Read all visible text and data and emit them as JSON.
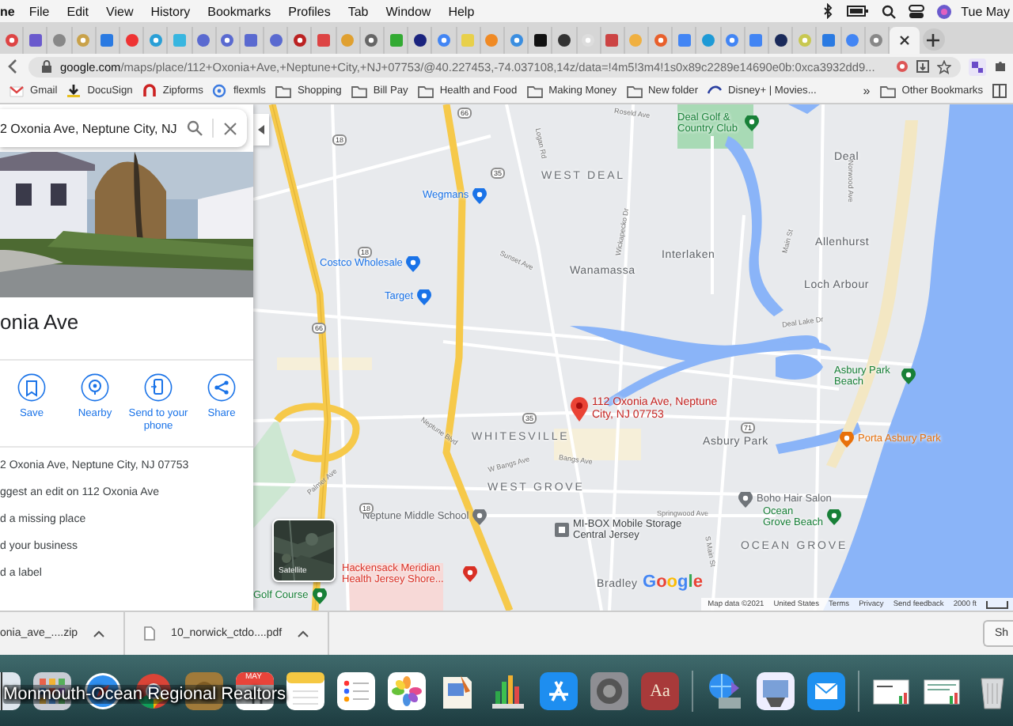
{
  "menu_bar": {
    "app": "ne",
    "menus": [
      "File",
      "Edit",
      "View",
      "History",
      "Bookmarks",
      "Profiles",
      "Tab",
      "Window",
      "Help"
    ],
    "clock": "Tue May"
  },
  "tabs": [
    {
      "selected": false
    },
    {
      "selected": false
    },
    {
      "selected": false
    },
    {
      "selected": false
    },
    {
      "selected": false
    },
    {
      "selected": false
    },
    {
      "selected": false
    },
    {
      "selected": false
    },
    {
      "selected": false
    },
    {
      "selected": false
    },
    {
      "selected": false
    },
    {
      "selected": false
    },
    {
      "selected": false
    },
    {
      "selected": false
    },
    {
      "selected": false
    },
    {
      "selected": false
    },
    {
      "selected": false
    },
    {
      "selected": false
    },
    {
      "selected": false
    },
    {
      "selected": false
    },
    {
      "selected": false
    },
    {
      "selected": false
    },
    {
      "selected": false
    },
    {
      "selected": false
    },
    {
      "selected": false
    },
    {
      "selected": false
    },
    {
      "selected": false
    },
    {
      "selected": false
    },
    {
      "selected": false
    },
    {
      "selected": false
    },
    {
      "selected": false
    },
    {
      "selected": false
    },
    {
      "selected": false
    },
    {
      "selected": false
    },
    {
      "selected": false
    },
    {
      "selected": false
    },
    {
      "selected": false
    },
    {
      "selected": true
    }
  ],
  "address_bar": {
    "url": "google.com/maps/place/112+Oxonia+Ave,+Neptune+City,+NJ+07753/@40.227453,-74.037108,14z/data=!4m5!3m4!1s0x89c2289e14690e0b:0xca3932dd9..."
  },
  "bookmarks": [
    {
      "kind": "site",
      "label": "Gmail"
    },
    {
      "kind": "site",
      "label": "DocuSign"
    },
    {
      "kind": "site",
      "label": "Zipforms"
    },
    {
      "kind": "site",
      "label": "flexmls"
    },
    {
      "kind": "folder",
      "label": "Shopping"
    },
    {
      "kind": "folder",
      "label": "Bill Pay"
    },
    {
      "kind": "folder",
      "label": "Health and Food"
    },
    {
      "kind": "folder",
      "label": "Making Money"
    },
    {
      "kind": "folder",
      "label": "New folder"
    },
    {
      "kind": "site",
      "label": "Disney+ | Movies..."
    }
  ],
  "bookmarks_more": "»",
  "other_bookmarks": "Other Bookmarks",
  "place_panel": {
    "search": "2 Oxonia Ave, Neptune City, NJ",
    "title": "onia Ave",
    "actions": [
      "Save",
      "Nearby",
      "Send to your phone",
      "Share"
    ],
    "details": [
      "2 Oxonia Ave, Neptune City, NJ 07753",
      "ggest an edit on 112 Oxonia Ave",
      "d a missing place",
      "d your business",
      "d a label"
    ]
  },
  "map": {
    "labels": [
      {
        "kind": "park",
        "text": "Deal Golf & Country Club"
      },
      {
        "kind": "area",
        "text": "WEST DEAL"
      },
      {
        "kind": "town",
        "text": "Deal"
      },
      {
        "kind": "shop",
        "text": "Wegmans"
      },
      {
        "kind": "town",
        "text": "Allenhurst"
      },
      {
        "kind": "town",
        "text": "Interlaken"
      },
      {
        "kind": "shop",
        "text": "Costco Wholesale"
      },
      {
        "kind": "town",
        "text": "Wanamassa"
      },
      {
        "kind": "town",
        "text": "Loch Arbour"
      },
      {
        "kind": "shop",
        "text": "Target"
      },
      {
        "kind": "park",
        "text": "Asbury Park Beach"
      },
      {
        "kind": "pin",
        "text": "112 Oxonia Ave, Neptune City, NJ 07753"
      },
      {
        "kind": "area",
        "text": "WHITESVILLE"
      },
      {
        "kind": "town",
        "text": "Asbury Park"
      },
      {
        "kind": "food",
        "text": "Porta Asbury Park"
      },
      {
        "kind": "area",
        "text": "WEST GROVE"
      },
      {
        "kind": "service",
        "text": "Boho Hair Salon"
      },
      {
        "kind": "school",
        "text": "Neptune Middle School"
      },
      {
        "kind": "park",
        "text": "Ocean Grove Beach"
      },
      {
        "kind": "business",
        "text": "MI-BOX Mobile Storage Central Jersey"
      },
      {
        "kind": "area",
        "text": "OCEAN GROVE"
      },
      {
        "kind": "hospital",
        "text": "Hackensack Meridian Health Jersey Shore..."
      },
      {
        "kind": "town",
        "text": "Bradley"
      },
      {
        "kind": "park",
        "text": "Golf Course"
      },
      {
        "kind": "street",
        "text": "Roseld Ave"
      },
      {
        "kind": "street",
        "text": "Logan Rd"
      },
      {
        "kind": "street",
        "text": "Sunset Ave"
      },
      {
        "kind": "street",
        "text": "Wickapecko Dr"
      },
      {
        "kind": "street",
        "text": "Norwood Ave"
      },
      {
        "kind": "street",
        "text": "Main St"
      },
      {
        "kind": "street",
        "text": "Deal Lake Dr"
      },
      {
        "kind": "street",
        "text": "Neptune Blvd"
      },
      {
        "kind": "street",
        "text": "W Bangs Ave"
      },
      {
        "kind": "street",
        "text": "Bangs Ave"
      },
      {
        "kind": "street",
        "text": "Palmer Ave"
      },
      {
        "kind": "street",
        "text": "Springwood Ave"
      },
      {
        "kind": "street",
        "text": "S Main St"
      },
      {
        "kind": "shield",
        "text": "18"
      },
      {
        "kind": "shield",
        "text": "35"
      },
      {
        "kind": "shield",
        "text": "18"
      },
      {
        "kind": "shield",
        "text": "66"
      },
      {
        "kind": "shield",
        "text": "66"
      },
      {
        "kind": "shield",
        "text": "35"
      },
      {
        "kind": "shield",
        "text": "71"
      },
      {
        "kind": "shield",
        "text": "18"
      }
    ],
    "logo": "Google",
    "satellite": "Satellite",
    "footer": [
      "Map data ©2021",
      "United States",
      "Terms",
      "Privacy",
      "Send feedback",
      "2000 ft"
    ]
  },
  "downloads": [
    {
      "name": "onia_ave_....zip"
    },
    {
      "name": "10_norwick_ctdo....pdf"
    }
  ],
  "show_all": "Sh",
  "dock": {
    "tooltip": "Monmouth-Ocean Regional Realtors",
    "calendar_month": "MAY",
    "dictionary": "Aa"
  }
}
